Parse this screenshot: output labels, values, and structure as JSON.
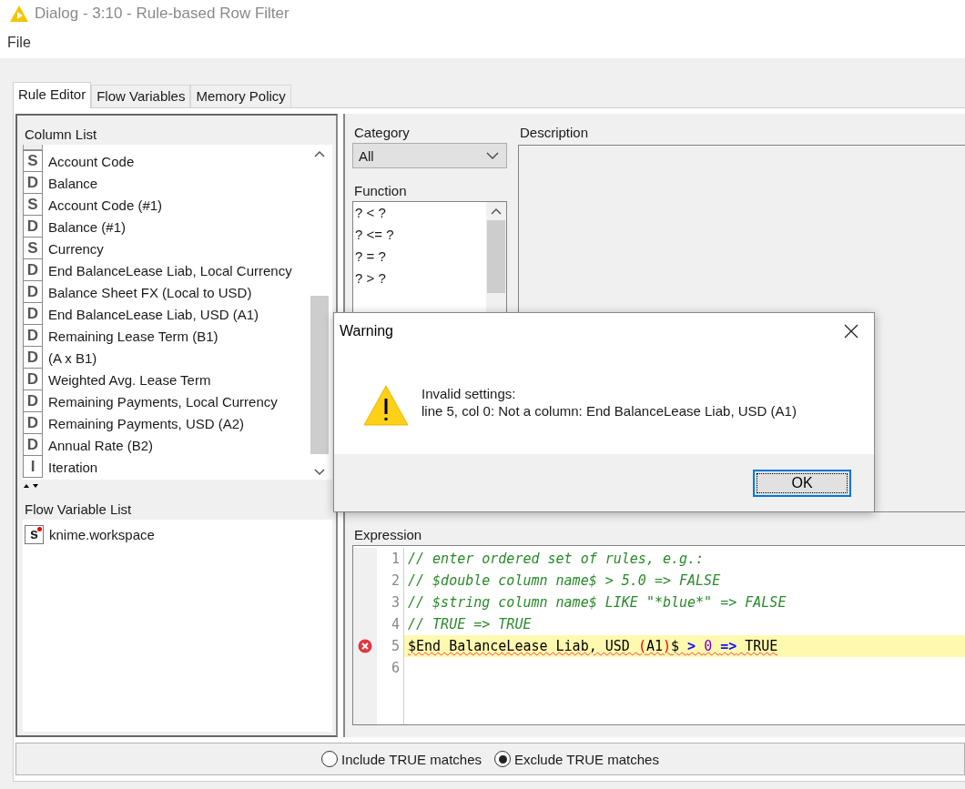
{
  "window": {
    "title": "Dialog - 3:10 - Rule-based Row Filter"
  },
  "menu": [
    "File"
  ],
  "tabs": [
    {
      "label": "Rule Editor",
      "selected": true
    },
    {
      "label": "Flow Variables",
      "selected": false
    },
    {
      "label": "Memory Policy",
      "selected": false
    }
  ],
  "column_list": {
    "title": "Column List",
    "items": [
      {
        "type": "S",
        "name": "Account Code"
      },
      {
        "type": "D",
        "name": "Balance"
      },
      {
        "type": "S",
        "name": "Account Code (#1)"
      },
      {
        "type": "D",
        "name": "Balance (#1)"
      },
      {
        "type": "S",
        "name": "Currency"
      },
      {
        "type": "D",
        "name": "End BalanceLease Liab, Local Currency"
      },
      {
        "type": "D",
        "name": "Balance Sheet FX  (Local to USD)"
      },
      {
        "type": "D",
        "name": "End BalanceLease Liab, USD (A1)"
      },
      {
        "type": "D",
        "name": "Remaining Lease Term (B1)"
      },
      {
        "type": "D",
        "name": "(A x B1)"
      },
      {
        "type": "D",
        "name": "Weighted Avg. Lease Term"
      },
      {
        "type": "D",
        "name": "Remaining Payments, Local Currency"
      },
      {
        "type": "D",
        "name": "Remaining Payments, USD (A2)"
      },
      {
        "type": "D",
        "name": "Annual Rate  (B2)"
      },
      {
        "type": "I",
        "name": "Iteration"
      }
    ]
  },
  "flow_variable_list": {
    "title": "Flow Variable List",
    "items": [
      {
        "type": "s",
        "name": "knime.workspace"
      }
    ]
  },
  "category": {
    "label": "Category",
    "value": "All"
  },
  "function": {
    "label": "Function",
    "items": [
      "? < ?",
      "? <= ?",
      "? = ?",
      "? > ?"
    ]
  },
  "description": {
    "label": "Description"
  },
  "expression": {
    "label": "Expression",
    "lines": [
      {
        "number": "1",
        "error": false,
        "tokens": [
          {
            "kind": "comment",
            "text": "// enter ordered set of rules, e.g.:"
          }
        ]
      },
      {
        "number": "2",
        "error": false,
        "tokens": [
          {
            "kind": "comment",
            "text": "// $double column name$ > 5.0 => FALSE"
          }
        ]
      },
      {
        "number": "3",
        "error": false,
        "tokens": [
          {
            "kind": "comment",
            "text": "// $string column name$ LIKE \"*blue*\" => FALSE"
          }
        ]
      },
      {
        "number": "4",
        "error": false,
        "tokens": [
          {
            "kind": "comment",
            "text": "// TRUE => TRUE"
          }
        ]
      },
      {
        "number": "5",
        "error": true,
        "tokens": [
          {
            "kind": "plain",
            "text": "$End BalanceLease Liab, USD "
          },
          {
            "kind": "bracket",
            "text": "("
          },
          {
            "kind": "plain",
            "text": "A1"
          },
          {
            "kind": "bracket",
            "text": ")"
          },
          {
            "kind": "plain",
            "text": "$ "
          },
          {
            "kind": "operator",
            "text": "> "
          },
          {
            "kind": "number",
            "text": "0 "
          },
          {
            "kind": "operator",
            "text": "=>"
          },
          {
            "kind": "plain",
            "text": " TRUE"
          }
        ]
      },
      {
        "number": "6",
        "error": false
      }
    ]
  },
  "match_options": [
    {
      "label": "Include TRUE matches",
      "selected": false
    },
    {
      "label": "Exclude TRUE matches",
      "selected": true
    }
  ],
  "warning_dialog": {
    "title": "Warning",
    "heading": "Invalid settings:",
    "message": "line 5, col 0: Not a column: End BalanceLease Liab, USD (A1)",
    "buttons": [
      "OK"
    ]
  }
}
